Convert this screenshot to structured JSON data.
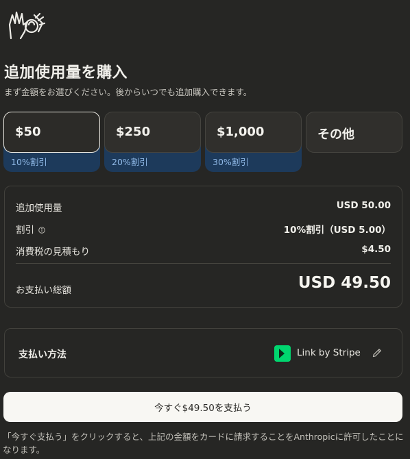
{
  "header": {
    "logo_icon": "hands-logo-icon",
    "title": "追加使用量を購入",
    "subtitle": "まず金額をお選びください。後からいつでも追加購入できます。"
  },
  "tiers": [
    {
      "amount": "$50",
      "discount": "10%割引",
      "selected": true
    },
    {
      "amount": "$250",
      "discount": "20%割引",
      "selected": false
    },
    {
      "amount": "$1,000",
      "discount": "30%割引",
      "selected": false
    },
    {
      "amount": "その他",
      "discount": "",
      "selected": false
    }
  ],
  "summary": {
    "usage_label": "追加使用量",
    "usage_value": "USD 50.00",
    "discount_label": "割引",
    "discount_value": "10%割引（USD 5.00）",
    "tax_label": "消費税の見積もり",
    "tax_value": "$4.50",
    "total_label": "お支払い総額",
    "total_value": "USD 49.50"
  },
  "payment": {
    "label": "支払い方法",
    "method": "Link by Stripe",
    "method_icon": "link-icon",
    "edit_icon": "pencil-icon"
  },
  "pay_button": {
    "label": "今すぐ$49.50を支払う"
  },
  "disclaimer": "「今すぐ支払う」をクリックすると、上記の金額をカードに請求することをAnthropicに許可したことになります。",
  "colors": {
    "background": "#262624",
    "discount_band": "#1d3a5b",
    "discount_text": "#8fb8e6",
    "link_green": "#00d66f",
    "button_bg": "#f8f7f3"
  }
}
